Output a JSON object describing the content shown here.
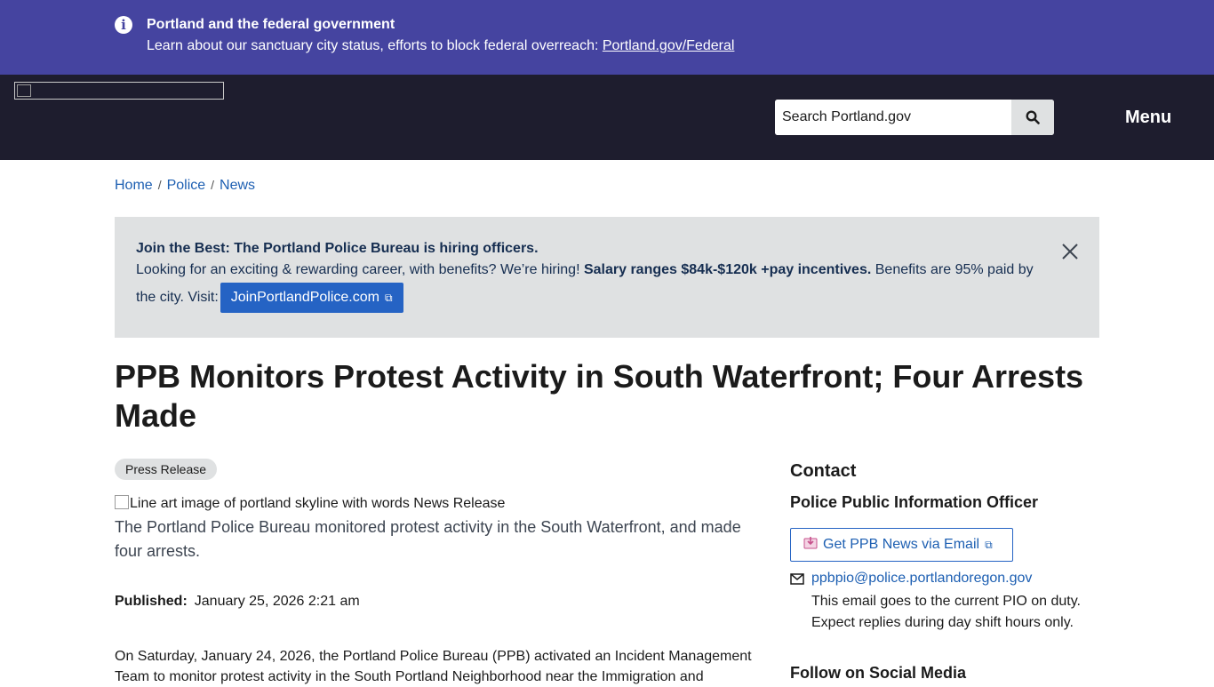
{
  "fed_banner": {
    "icon": "info-icon",
    "title": "Portland and the federal government",
    "text": "Learn about our sanctuary city status, efforts to block federal overreach: ",
    "link": "Portland.gov/Federal"
  },
  "header": {
    "search_placeholder": "Search Portland.gov",
    "menu_label": "Menu"
  },
  "breadcrumb": [
    "Home",
    "Police",
    "News"
  ],
  "hiring_alert": {
    "title": "Join the Best: The Portland Police Bureau is hiring officers.",
    "text_start": "Looking for an exciting & rewarding career, with benefits? We’re hiring! ",
    "text_bold": "Salary ranges $84k-$120k +pay incentives.",
    "text_end": " Benefits are 95% paid by",
    "visit_label": "the city. Visit: ",
    "button": "JoinPortlandPolice.com"
  },
  "article": {
    "title": "PPB Monitors Protest Activity in South Waterfront; Four Arrests Made",
    "badge": "Press Release",
    "image_alt": "Line art image of portland skyline with words News Release",
    "caption": "The Portland Police Bureau monitored protest activity in the South Waterfront, and made four arrests.",
    "published_label": "Published:",
    "published_date": "January 25, 2026 2:21 am",
    "body": "On Saturday, January 24, 2026, the Portland Police Bureau (PPB) activated an Incident Management Team to monitor protest activity in the South Portland Neighborhood near the Immigration and"
  },
  "sidebar": {
    "contact_heading": "Contact",
    "pio_heading": "Police Public Information Officer",
    "email_button": "Get PPB News via Email",
    "email": "ppbpio@police.portlandoregon.gov",
    "email_note": "This email goes to the current PIO on duty. Expect replies during day shift hours only.",
    "social_heading": "Follow on Social Media"
  },
  "colors": {
    "fed_banner_bg": "#4544a0",
    "header_bg": "#1e1d2e",
    "alert_bg": "#dfe1e2",
    "link": "#1d5fb2",
    "primary_button": "#2563c4"
  }
}
